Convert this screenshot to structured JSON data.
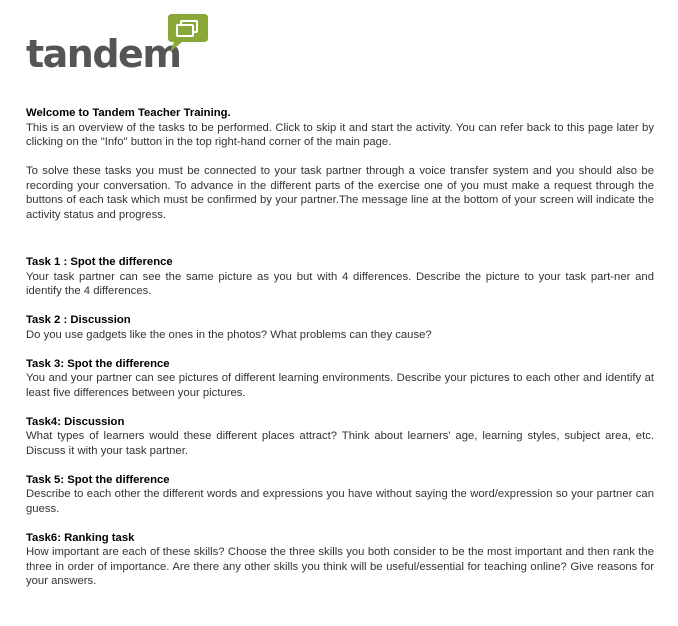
{
  "logo": {
    "text": "tandem",
    "icon": "speech-bubble-logo-icon",
    "bubble_color": "#8aa838"
  },
  "intro": {
    "title": "Welcome to Tandem Teacher Training.",
    "paragraph1": "This is an overview of the tasks to be performed. Click to skip it and start the activity. You can refer back to this page later by clicking on the \"Info\" button in the top right-hand corner of the main page.",
    "paragraph2": "To solve these tasks you must be connected to your task partner through a voice transfer system and you should also be recording your conversation. To advance in the different parts of the exercise one of you must make a request through the buttons of each task which must be confirmed by your partner.The message line at the bottom of your screen will indicate the activity status and progress."
  },
  "tasks": [
    {
      "title": "Task 1 : Spot the difference",
      "description": "Your task partner can see the same picture as you but with 4 differences. Describe the picture to your task part-ner and identify the 4 differences."
    },
    {
      "title": "Task 2 : Discussion",
      "description": "Do you use gadgets like the ones in the photos? What problems can they cause?"
    },
    {
      "title": "Task 3: Spot the difference",
      "description": "You and your partner can see pictures of different learning environments. Describe your pictures to each other and identify at least five differences between your pictures."
    },
    {
      "title": "Task4: Discussion",
      "description": "What types of learners would these different places attract? Think about learners' age, learning styles, subject area, etc. Discuss it with your task partner."
    },
    {
      "title": "Task 5: Spot the difference",
      "description": "Describe to each other the different words and expressions you have without saying the word/expression so your partner can guess."
    },
    {
      "title": "Task6: Ranking task",
      "description": "How important are each of these skills? Choose the three skills you both consider to be the most important and then rank the three in order of importance. Are there any other skills you think will be useful/essential for teaching online? Give reasons for your answers."
    }
  ]
}
